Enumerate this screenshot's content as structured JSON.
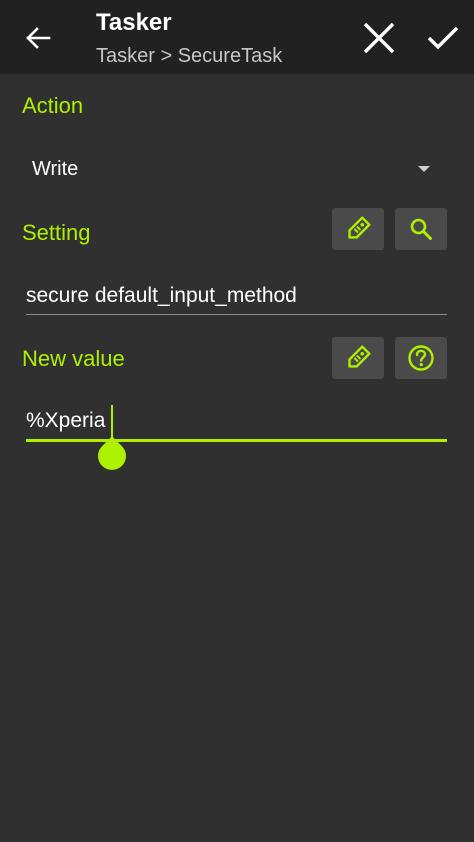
{
  "appbar": {
    "title": "Tasker",
    "subtitle": "Tasker > SecureTask",
    "back_icon": "arrow-left-icon",
    "cancel_icon": "close-icon",
    "confirm_icon": "check-icon"
  },
  "action": {
    "label": "Action",
    "selected": "Write"
  },
  "setting": {
    "label": "Setting",
    "value": "secure default_input_method",
    "buttons": [
      "tag-icon",
      "search-icon"
    ]
  },
  "new_value": {
    "label": "New value",
    "value": "%Xperia",
    "buttons": [
      "tag-icon",
      "help-icon"
    ]
  },
  "colors": {
    "accent": "#aef000",
    "background": "#303030",
    "appbar": "#212121",
    "button_bg": "#4a4a4a"
  }
}
